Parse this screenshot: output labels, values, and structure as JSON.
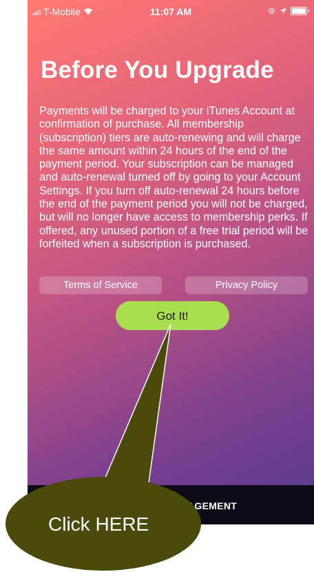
{
  "status_bar": {
    "carrier": "T-Mobile",
    "time": "11:07 AM"
  },
  "screen": {
    "title": "Before You Upgrade",
    "body": "Payments will be charged to your iTunes Account at confirmation of purchase. All membership (subscription) tiers are auto-renewing and will charge the same amount within 24 hours of the end of the payment period. Your subscription can be managed and auto-renewal turned off by going to your Account Settings. If you turn off auto-renewal 24 hours before the end of the payment period you will not be charged, but will no longer have access to membership perks. If offered, any unused portion of a free trial period will be forfeited when a subscription is purchased.",
    "terms_label": "Terms of Service",
    "privacy_label": "Privacy Policy",
    "got_it_label": "Got It!",
    "bottom_bar_label": "AGEMENT"
  },
  "callout": {
    "text": "Click HERE",
    "fill_color": "#4a4a0a"
  },
  "colors": {
    "accent_button": "#a9df4f",
    "gradient_top": "#ff7a72",
    "gradient_bottom": "#553a8a",
    "bottom_bar": "#0d0c16"
  },
  "icons": [
    "signal-icon",
    "wifi-icon",
    "location-icon",
    "battery-icon"
  ]
}
